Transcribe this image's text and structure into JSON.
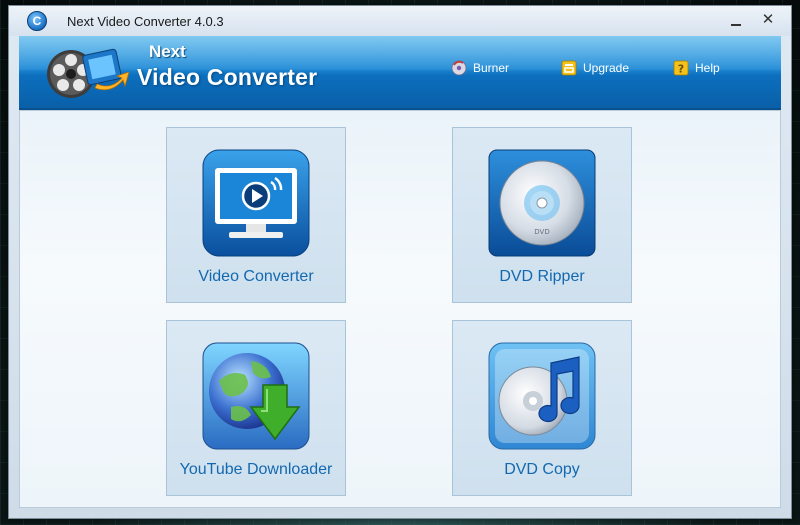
{
  "window": {
    "title": "Next Video Converter 4.0.3",
    "app_icon_glyph": "C",
    "minimize_glyph": "",
    "close_glyph": "✕"
  },
  "header": {
    "brand_line1": "Next",
    "brand_line2": "Video Converter",
    "links": [
      {
        "label": "Burner",
        "icon": "burner-icon"
      },
      {
        "label": "Upgrade",
        "icon": "upgrade-icon"
      },
      {
        "label": "Help",
        "icon": "help-icon"
      }
    ]
  },
  "tools": [
    {
      "label": "Video Converter",
      "icon": "monitor-play-icon"
    },
    {
      "label": "DVD Ripper",
      "icon": "dvd-disc-icon"
    },
    {
      "label": "YouTube Downloader",
      "icon": "globe-download-icon"
    },
    {
      "label": "DVD Copy",
      "icon": "disc-music-icon"
    }
  ],
  "colors": {
    "header_blue": "#1f8ad6",
    "label_blue": "#1369b0",
    "download_green": "#3fae2a"
  }
}
